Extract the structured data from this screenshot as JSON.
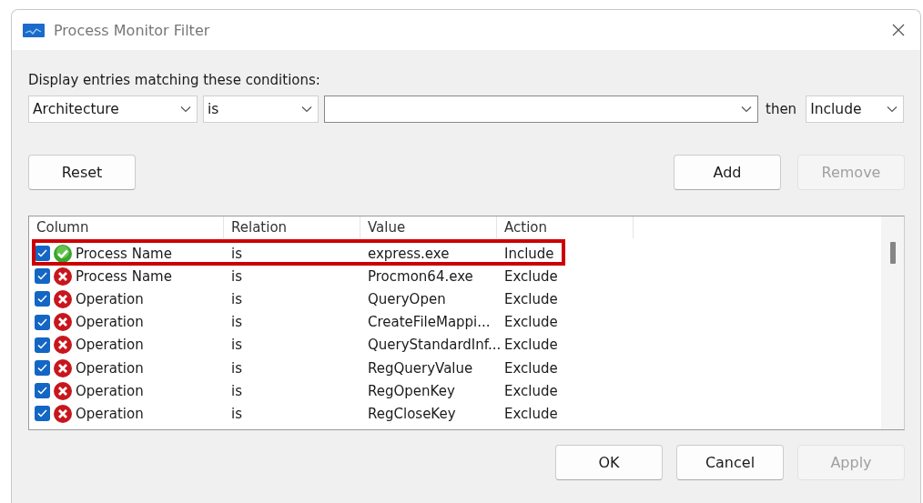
{
  "window": {
    "title": "Process Monitor Filter"
  },
  "prompt": "Display entries matching these conditions:",
  "condition": {
    "column": "Architecture",
    "relation": "is",
    "then_label": "then",
    "action": "Include"
  },
  "buttons_top": [
    {
      "label": "Reset",
      "disabled": false
    },
    {
      "label": "Add",
      "disabled": false
    },
    {
      "label": "Remove",
      "disabled": true
    }
  ],
  "table": {
    "columns": [
      "Column",
      "Relation",
      "Value",
      "Action"
    ],
    "rows": [
      {
        "checked": true,
        "kind": "include",
        "column": "Process Name",
        "relation": "is",
        "value": "express.exe",
        "action": "Include",
        "highlighted": true
      },
      {
        "checked": true,
        "kind": "exclude",
        "column": "Process Name",
        "relation": "is",
        "value": "Procmon64.exe",
        "action": "Exclude",
        "highlighted": false
      },
      {
        "checked": true,
        "kind": "exclude",
        "column": "Operation",
        "relation": "is",
        "value": "QueryOpen",
        "action": "Exclude",
        "highlighted": false
      },
      {
        "checked": true,
        "kind": "exclude",
        "column": "Operation",
        "relation": "is",
        "value": "CreateFileMappi...",
        "action": "Exclude",
        "highlighted": false
      },
      {
        "checked": true,
        "kind": "exclude",
        "column": "Operation",
        "relation": "is",
        "value": "QueryStandardInf...",
        "action": "Exclude",
        "highlighted": false
      },
      {
        "checked": true,
        "kind": "exclude",
        "column": "Operation",
        "relation": "is",
        "value": "RegQueryValue",
        "action": "Exclude",
        "highlighted": false
      },
      {
        "checked": true,
        "kind": "exclude",
        "column": "Operation",
        "relation": "is",
        "value": "RegOpenKey",
        "action": "Exclude",
        "highlighted": false
      },
      {
        "checked": true,
        "kind": "exclude",
        "column": "Operation",
        "relation": "is",
        "value": "RegCloseKey",
        "action": "Exclude",
        "highlighted": false
      }
    ]
  },
  "buttons_bottom": [
    {
      "label": "OK",
      "disabled": false
    },
    {
      "label": "Cancel",
      "disabled": false
    },
    {
      "label": "Apply",
      "disabled": true
    }
  ]
}
